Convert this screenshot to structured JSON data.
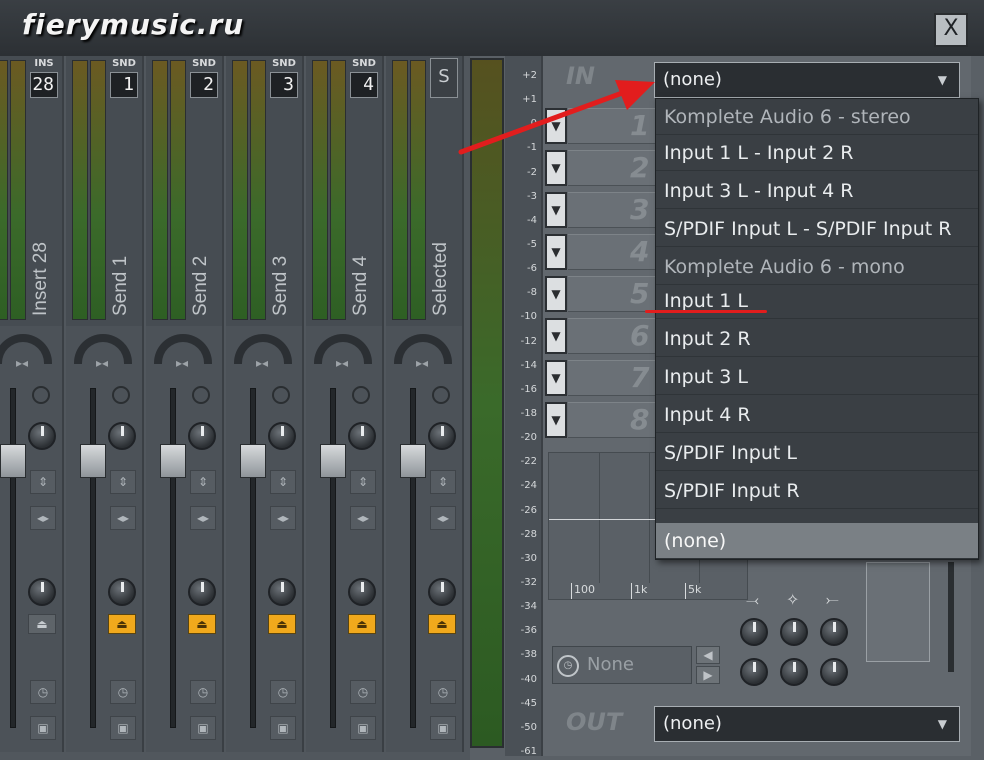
{
  "window": {
    "title": "fierymusic.ru",
    "close_label": "X"
  },
  "strips": [
    {
      "tag": "INS",
      "number": "28",
      "name": "Insert 28"
    },
    {
      "tag": "SND",
      "number": "1",
      "name": "Send 1"
    },
    {
      "tag": "SND",
      "number": "2",
      "name": "Send 2"
    },
    {
      "tag": "SND",
      "number": "3",
      "name": "Send 3"
    },
    {
      "tag": "SND",
      "number": "4",
      "name": "Send 4"
    },
    {
      "tag": "",
      "number": "S",
      "name": "Selected"
    }
  ],
  "db_scale": [
    "+2",
    "+1",
    "0",
    "-1",
    "-2",
    "-3",
    "-4",
    "-5",
    "-6",
    "-8",
    "-10",
    "-12",
    "-14",
    "-16",
    "-18",
    "-20",
    "-22",
    "-24",
    "-26",
    "-28",
    "-30",
    "-32",
    "-34",
    "-36",
    "-38",
    "-40",
    "-45",
    "-50",
    "-61"
  ],
  "input": {
    "label": "IN",
    "selected": "(none)"
  },
  "output": {
    "label": "OUT",
    "selected": "(none)"
  },
  "slots": [
    "1",
    "2",
    "3",
    "4",
    "5",
    "6",
    "7",
    "8"
  ],
  "eq_freq_labels": [
    "100",
    "1k",
    "5k"
  ],
  "linked_track": "None",
  "input_menu": {
    "items": [
      {
        "label": "Komplete Audio 6 - stereo",
        "kind": "header"
      },
      {
        "label": "Input 1 L - Input 2 R",
        "kind": "item"
      },
      {
        "label": "Input 3 L - Input 4 R",
        "kind": "item"
      },
      {
        "label": "S/PDIF Input L - S/PDIF Input R",
        "kind": "item"
      },
      {
        "label": "Komplete Audio 6 - mono",
        "kind": "header"
      },
      {
        "label": "Input 1 L",
        "kind": "item"
      },
      {
        "label": "Input 2 R",
        "kind": "item"
      },
      {
        "label": "Input 3 L",
        "kind": "item"
      },
      {
        "label": "Input 4 R",
        "kind": "item"
      },
      {
        "label": "S/PDIF Input L",
        "kind": "item"
      },
      {
        "label": "S/PDIF Input R",
        "kind": "item"
      },
      {
        "label": "(none)",
        "kind": "selected"
      }
    ]
  },
  "colors": {
    "annotation_red": "#e21d1d",
    "led_green": "#3fd62a",
    "orange_button": "#f1a91c"
  }
}
